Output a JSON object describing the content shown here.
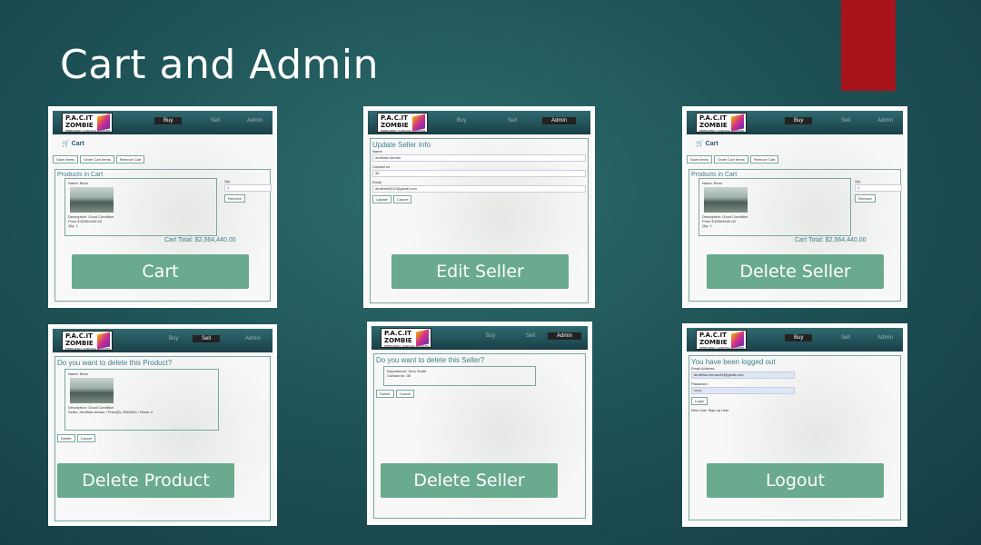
{
  "title": "Cart and Admin",
  "logo": {
    "line1": "P.A.C.IT",
    "line2": "ZOMBIE",
    "tagline": "EMERGENCY SURVIVAL SUPPLIES"
  },
  "nav": {
    "buy": "Buy",
    "sell": "Sell",
    "admin": "Admin"
  },
  "cart_page": {
    "heading": "Cart",
    "tabs": [
      "Save Items",
      "Order Cart Items",
      "Remove Cart"
    ],
    "panel_title": "Products in Cart",
    "name": "Name: Benz",
    "description": "Description: Good Condition",
    "price": "Price $ $2564440.00",
    "qty_line": "Qty: 1",
    "qty_label": "Qty",
    "qty_value": "1",
    "remove": "Remove",
    "total": "Cart Total: $2,564,440.00"
  },
  "edit_seller_page": {
    "title": "Update Seller Info",
    "name_label": "Name",
    "name_value": "devilfala rinman",
    "contact_label": "Contact no",
    "contact_value": "35",
    "email_label": "Email",
    "email_value": "devilfala0010@gmail.com",
    "update": "Update",
    "cancel": "Cancel"
  },
  "delete_product_page": {
    "title": "Do you want to delete this Product?",
    "name": "Name: Benz",
    "description": "Description: Good Condition",
    "detail": "Seller: devilfala rinman / Price($): 2564440 / Stock: e",
    "delete": "Delete",
    "cancel": "Cancel"
  },
  "delete_seller_page": {
    "title": "Do you want to delete this Seller?",
    "department": "Department: John Smith",
    "contact": "Contact no: 35",
    "delete": "Delete",
    "cancel": "Cancel"
  },
  "logout_page": {
    "title": "You have been logged out",
    "email_label": "Email Address",
    "email_value": "devilfala.rinman34@gmail.com",
    "password_label": "Password",
    "password_value": "••••••",
    "login": "Login",
    "footer": "New User Sign up here"
  },
  "captions": {
    "cart": "Cart",
    "edit_seller": "Edit Seller",
    "delete_seller_top": "Delete Seller",
    "delete_product": "Delete Product",
    "delete_seller_bottom": "Delete Seller",
    "logout": "Logout"
  },
  "colors": {
    "accent": "#a8141a",
    "caption": "#6aaa8e",
    "background": "#1f5458"
  }
}
